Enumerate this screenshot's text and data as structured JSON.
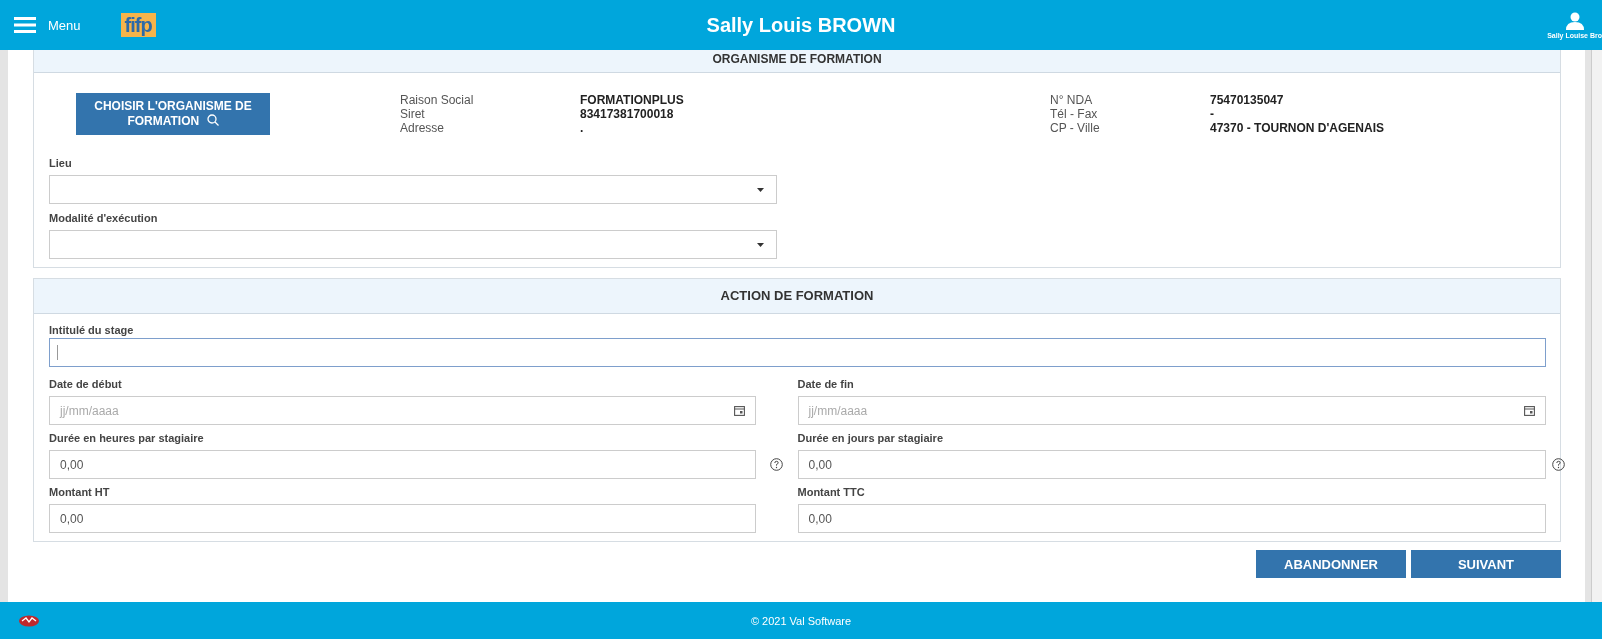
{
  "header": {
    "menu_label": "Menu",
    "logo_text": "fifp",
    "title": "Sally Louis BROWN",
    "user_name": "Sally Louise Bro"
  },
  "organisme": {
    "title": "ORGANISME DE FORMATION",
    "choose_button": "CHOISIR L'ORGANISME DE FORMATION",
    "info_left": [
      {
        "label": "Raison Social",
        "value": "FORMATIONPLUS"
      },
      {
        "label": "Siret",
        "value": "83417381700018"
      },
      {
        "label": "Adresse",
        "value": "."
      }
    ],
    "info_right": [
      {
        "label": "N° NDA",
        "value": "75470135047"
      },
      {
        "label": "Tél - Fax",
        "value": "-"
      },
      {
        "label": "CP - Ville",
        "value": "47370 - TOURNON D'AGENAIS"
      }
    ],
    "selects": [
      {
        "label": "Lieu"
      },
      {
        "label": "Modalité d'exécution"
      }
    ]
  },
  "action": {
    "title": "ACTION DE FORMATION",
    "title_field": {
      "label": "Intitulé du stage",
      "focused": true
    },
    "rows": [
      [
        {
          "label": "Date de début",
          "kind": "date",
          "placeholder": "jj/mm/aaaa"
        },
        {
          "label": "Date de fin",
          "kind": "date",
          "placeholder": "jj/mm/aaaa"
        }
      ],
      [
        {
          "label": "Durée en heures par stagiaire",
          "kind": "number_help",
          "value": "0,00"
        },
        {
          "label": "Durée en jours par stagiaire",
          "kind": "number_help",
          "value": "0,00"
        }
      ],
      [
        {
          "label": "Montant HT",
          "kind": "number",
          "value": "0,00"
        },
        {
          "label": "Montant TTC",
          "kind": "number",
          "value": "0,00"
        }
      ]
    ]
  },
  "buttons": [
    "ABANDONNER",
    "SUIVANT"
  ],
  "footer": "© 2021 Val Software"
}
